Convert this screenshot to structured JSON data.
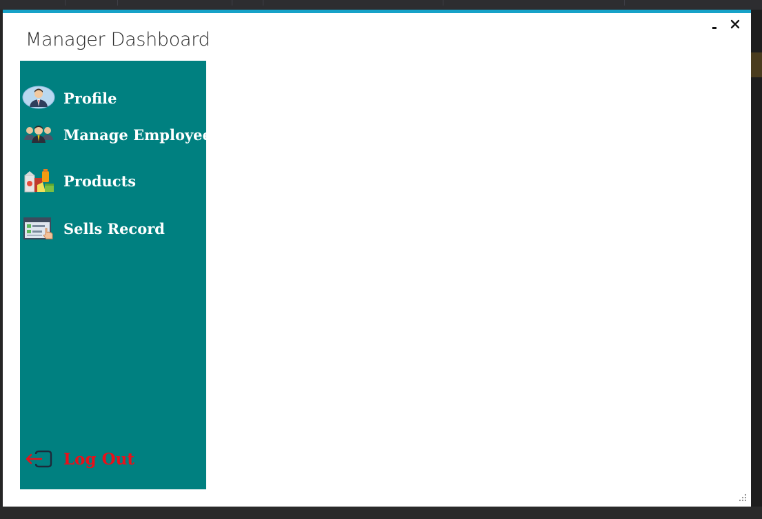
{
  "window": {
    "title": "Manager Dashboard",
    "minimize_label": "-",
    "close_label": "✕"
  },
  "colors": {
    "accent": "#17a2c8",
    "sidebar": "#008080",
    "nav_text": "#ffffff",
    "logout_text": "#e8101a"
  },
  "sidebar": {
    "items": [
      {
        "label": "Profile",
        "icon": "profile-icon"
      },
      {
        "label": "Manage Employee",
        "icon": "employees-icon"
      },
      {
        "label": "Products",
        "icon": "products-icon"
      },
      {
        "label": "Sells Record",
        "icon": "sales-record-icon"
      }
    ],
    "logout": {
      "label": "Log Out",
      "icon": "logout-icon"
    }
  }
}
